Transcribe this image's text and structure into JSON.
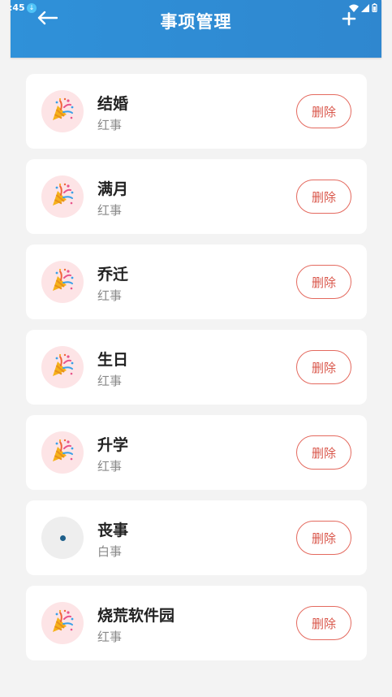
{
  "status_bar": {
    "time": ":45"
  },
  "app_bar": {
    "title": "事项管理"
  },
  "items": [
    {
      "name": "结婚",
      "type": "红事",
      "icon": "party-popper-icon",
      "delete_label": "删除"
    },
    {
      "name": "满月",
      "type": "红事",
      "icon": "party-popper-icon",
      "delete_label": "删除"
    },
    {
      "name": "乔迁",
      "type": "红事",
      "icon": "party-popper-icon",
      "delete_label": "删除"
    },
    {
      "name": "生日",
      "type": "红事",
      "icon": "party-popper-icon",
      "delete_label": "删除"
    },
    {
      "name": "升学",
      "type": "红事",
      "icon": "party-popper-icon",
      "delete_label": "删除"
    },
    {
      "name": "丧事",
      "type": "白事",
      "icon": "dot-icon",
      "delete_label": "删除"
    },
    {
      "name": "烧荒软件园",
      "type": "红事",
      "icon": "party-popper-icon",
      "delete_label": "删除"
    }
  ],
  "colors": {
    "app_bar": "#2f8ed8",
    "red_avatar_bg": "#fde4e6",
    "white_avatar_bg": "#eeeeee",
    "delete_border": "#e46a5f"
  }
}
